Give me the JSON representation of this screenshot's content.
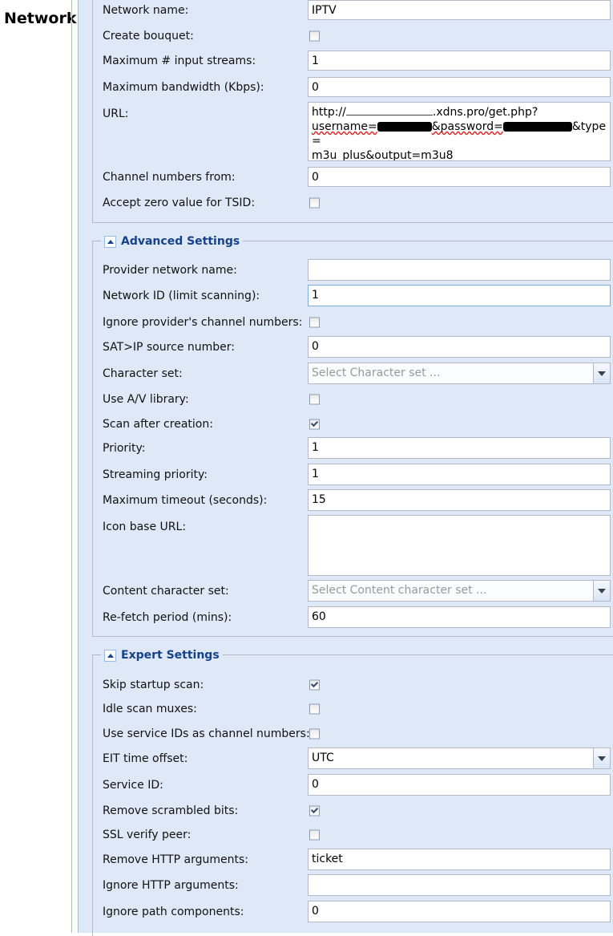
{
  "page_label": "Network:",
  "general": {
    "network_name": {
      "label": "Network name:",
      "value": "IPTV"
    },
    "create_bouquet": {
      "label": "Create bouquet:",
      "checked": false
    },
    "max_input_streams": {
      "label": "Maximum # input streams:",
      "value": "1"
    },
    "max_bandwidth": {
      "label": "Maximum bandwidth (Kbps):",
      "value": "0"
    },
    "url": {
      "label": "URL:",
      "part1": "http://",
      "part2": ".xdns.pro/get.php?",
      "part3": "username=",
      "part4": "&password=",
      "part5": "&type=",
      "part6": "m3u_plus&output=m3u8"
    },
    "channel_numbers_from": {
      "label": "Channel numbers from:",
      "value": "0"
    },
    "accept_zero_tsid": {
      "label": "Accept zero value for TSID:",
      "checked": false
    }
  },
  "advanced": {
    "title": "Advanced Settings",
    "provider_network_name": {
      "label": "Provider network name:",
      "value": ""
    },
    "network_id": {
      "label": "Network ID (limit scanning):",
      "value": "1"
    },
    "ignore_channel_numbers": {
      "label": "Ignore provider's channel numbers:",
      "checked": false
    },
    "satip_source": {
      "label": "SAT>IP source number:",
      "value": "0"
    },
    "character_set": {
      "label": "Character set:",
      "placeholder": "Select Character set ..."
    },
    "use_av_library": {
      "label": "Use A/V library:",
      "checked": false
    },
    "scan_after_creation": {
      "label": "Scan after creation:",
      "checked": true
    },
    "priority": {
      "label": "Priority:",
      "value": "1"
    },
    "streaming_priority": {
      "label": "Streaming priority:",
      "value": "1"
    },
    "max_timeout": {
      "label": "Maximum timeout (seconds):",
      "value": "15"
    },
    "icon_base_url": {
      "label": "Icon base URL:",
      "value": ""
    },
    "content_character_set": {
      "label": "Content character set:",
      "placeholder": "Select Content character set ..."
    },
    "refetch_period": {
      "label": "Re-fetch period (mins):",
      "value": "60"
    }
  },
  "expert": {
    "title": "Expert Settings",
    "skip_startup_scan": {
      "label": "Skip startup scan:",
      "checked": true
    },
    "idle_scan_muxes": {
      "label": "Idle scan muxes:",
      "checked": false
    },
    "service_ids_as_channel_numbers": {
      "label": "Use service IDs as channel numbers:",
      "checked": false
    },
    "eit_time_offset": {
      "label": "EIT time offset:",
      "value": "UTC"
    },
    "service_id": {
      "label": "Service ID:",
      "value": "0"
    },
    "remove_scrambled_bits": {
      "label": "Remove scrambled bits:",
      "checked": true
    },
    "ssl_verify_peer": {
      "label": "SSL verify peer:",
      "checked": false
    },
    "remove_http_arguments": {
      "label": "Remove HTTP arguments:",
      "value": "ticket"
    },
    "ignore_http_arguments": {
      "label": "Ignore HTTP arguments:",
      "value": ""
    },
    "ignore_path_components": {
      "label": "Ignore path components:",
      "value": "0"
    }
  }
}
